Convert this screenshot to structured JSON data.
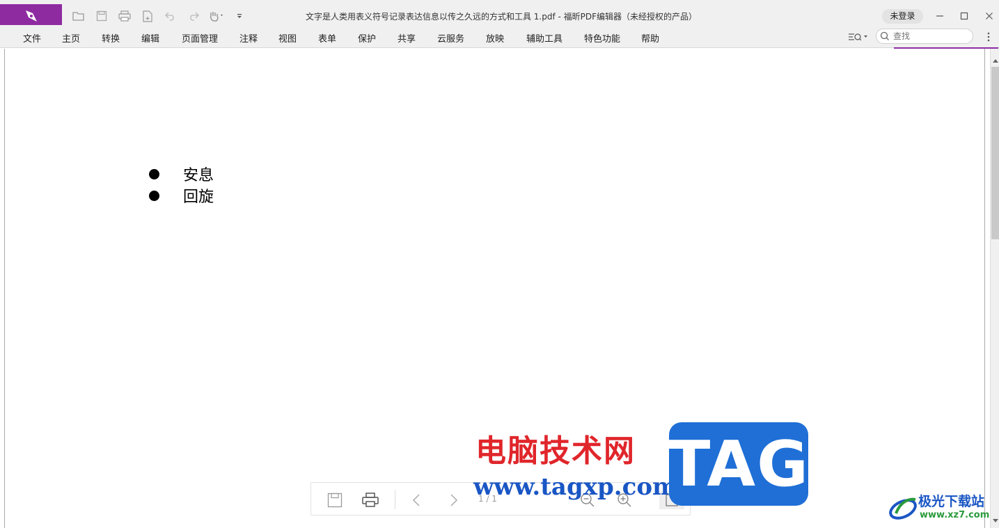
{
  "window": {
    "title": "文字是人类用表义符号记录表达信息以传之久远的方式和工具 1.pdf - 福昕PDF编辑器（未经授权的产品）",
    "login_label": "未登录"
  },
  "quick_access": [
    "folder-open-icon",
    "save-icon",
    "print-icon",
    "new-file-icon",
    "undo-icon",
    "redo-icon",
    "hand-tool-icon",
    "customize-icon"
  ],
  "menu": {
    "items": [
      "文件",
      "主页",
      "转换",
      "编辑",
      "页面管理",
      "注释",
      "视图",
      "表单",
      "保护",
      "共享",
      "云服务",
      "放映",
      "辅助工具",
      "特色功能",
      "帮助"
    ],
    "search_placeholder": "查找"
  },
  "document": {
    "bullets": [
      "安息",
      "回旋"
    ]
  },
  "float_toolbar": {
    "page_indicator": "1 / 1"
  },
  "watermarks": {
    "cn_site": "电脑技术网",
    "url": "www.tagxp.com",
    "tag": "TAG",
    "site2": "极光下载站",
    "site2_url": "www.xz7.com"
  },
  "colors": {
    "brand": "#8e2ba1",
    "watermark_red": "#e0262b",
    "watermark_blue": "#1f6fd6"
  }
}
